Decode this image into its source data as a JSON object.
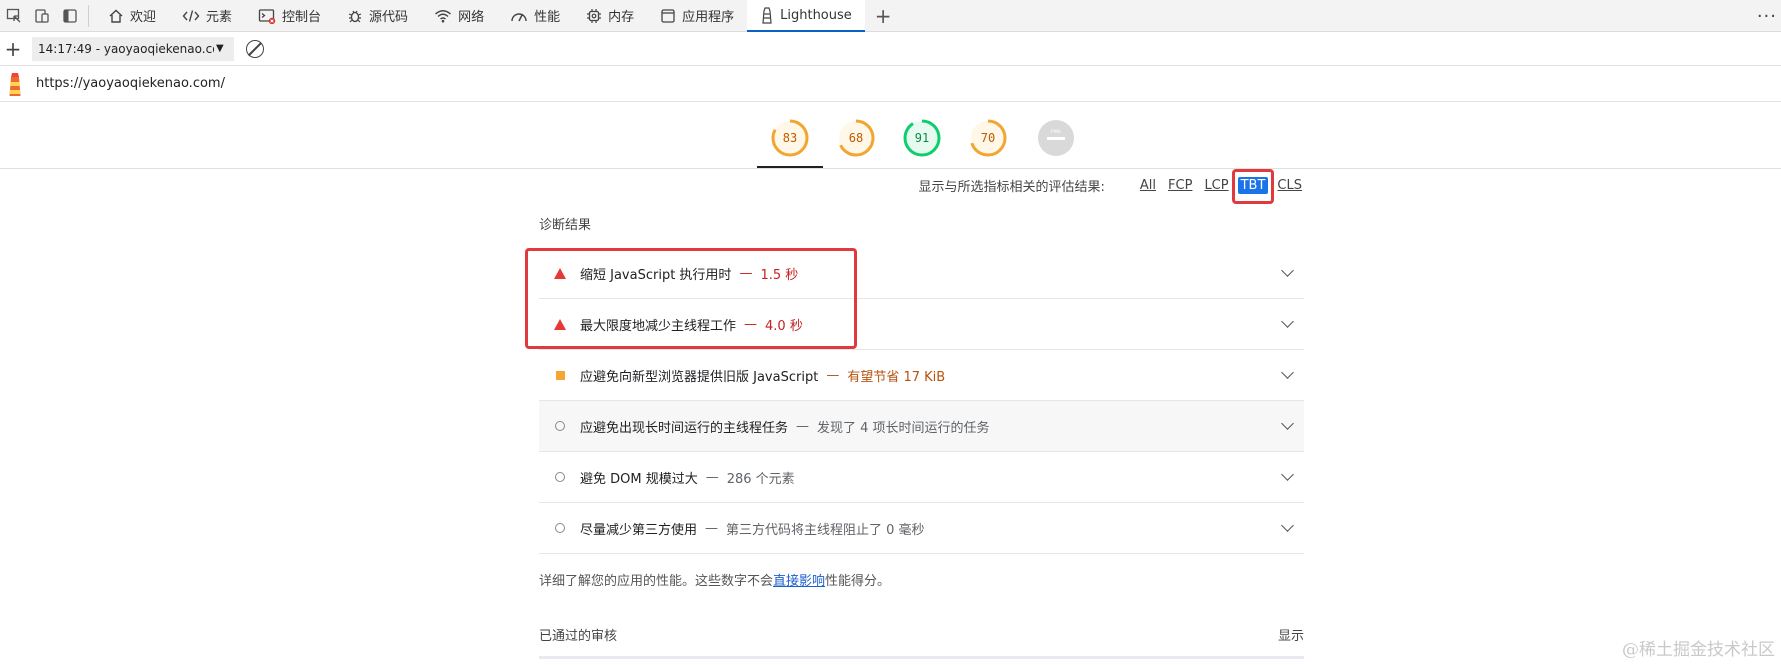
{
  "devtools_tabs": [
    {
      "label": "欢迎",
      "icon": "home-icon"
    },
    {
      "label": "元素",
      "icon": "code-icon"
    },
    {
      "label": "控制台",
      "icon": "console-icon"
    },
    {
      "label": "源代码",
      "icon": "bug-icon"
    },
    {
      "label": "网络",
      "icon": "wifi-icon"
    },
    {
      "label": "性能",
      "icon": "speedometer-icon"
    },
    {
      "label": "内存",
      "icon": "chip-icon"
    },
    {
      "label": "应用程序",
      "icon": "window-icon"
    },
    {
      "label": "Lighthouse",
      "icon": "lighthouse-icon",
      "active": true
    }
  ],
  "report": {
    "selected": "14:17:49 - yaoyaoqiekenao.cor",
    "url": "https://yaoyaoqiekenao.com/"
  },
  "scores": [
    {
      "value": "83",
      "color": "#f2a531"
    },
    {
      "value": "68",
      "color": "#f2a531"
    },
    {
      "value": "91",
      "color": "#0cce6b"
    },
    {
      "value": "70",
      "color": "#f2a531"
    },
    {
      "value": "PWA",
      "color": "#cccccc"
    }
  ],
  "filter": {
    "label": "显示与所选指标相关的评估结果:",
    "options": [
      "All",
      "FCP",
      "LCP",
      "TBT",
      "CLS"
    ],
    "selected": "TBT"
  },
  "diagnostics": {
    "title": "诊断结果",
    "audits": [
      {
        "title": "缩短 JavaScript 执行用时",
        "display": "1.5 秒",
        "status": "fail"
      },
      {
        "title": "最大限度地减少主线程工作",
        "display": "4.0 秒",
        "status": "fail"
      },
      {
        "title": "应避免向新型浏览器提供旧版 JavaScript",
        "display": "有望节省 17 KiB",
        "status": "average"
      },
      {
        "title": "应避免出现长时间运行的主线程任务",
        "display": "发现了 4 项长时间运行的任务",
        "status": "info"
      },
      {
        "title": "避免 DOM 规模过大",
        "display": "286 个元素",
        "status": "info"
      },
      {
        "title": "尽量减少第三方使用",
        "display": "第三方代码将主线程阻止了 0 毫秒",
        "status": "info"
      }
    ],
    "separator": "—",
    "note_before": "详细了解您的应用的性能。这些数字不会",
    "note_link": "直接影响",
    "note_after": "性能得分。"
  },
  "passed": {
    "title": "已通过的审核",
    "toggle": "显示"
  },
  "watermark": "@稀土掘金技术社区",
  "colors": {
    "accent": "#1a73e8",
    "highlight": "#e0393e",
    "fail": "#c5221f",
    "average": "#b7530e"
  }
}
